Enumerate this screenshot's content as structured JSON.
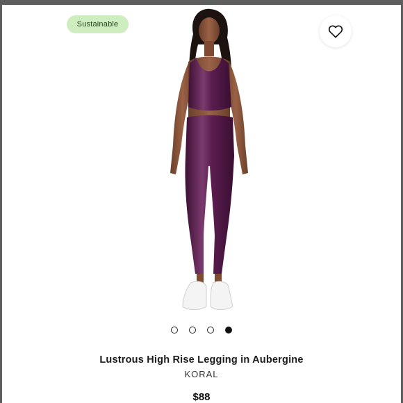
{
  "badge": {
    "label": "Sustainable"
  },
  "favorite": {
    "icon": "heart-icon"
  },
  "gallery": {
    "slide_count": 4,
    "active_index": 3
  },
  "product": {
    "title": "Lustrous High Rise Legging in Aubergine",
    "brand": "KORAL",
    "price": "$88",
    "color_swatch": "#5a1d4e"
  },
  "colors": {
    "badge_bg": "#cfeec0",
    "page_bg": "#ffffff",
    "frame": "#5e5e5e"
  }
}
